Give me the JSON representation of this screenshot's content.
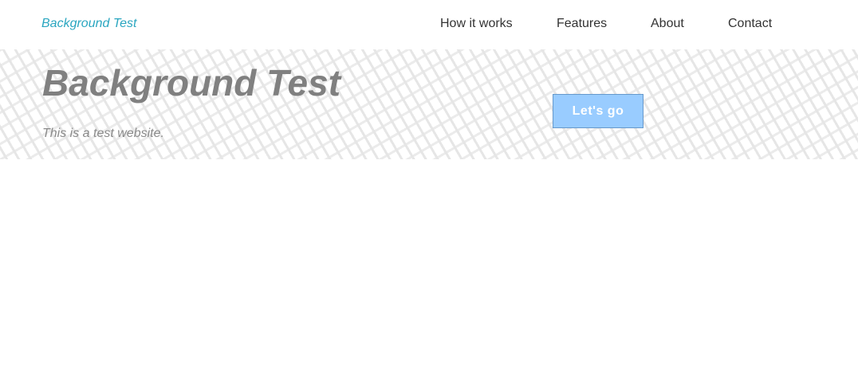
{
  "navbar": {
    "brand": "Background Test",
    "links": [
      "How it works",
      "Features",
      "About",
      "Contact"
    ]
  },
  "hero": {
    "title": "Background Test",
    "subtitle": "This is a test website.",
    "cta_label": "Let's go"
  },
  "colors": {
    "brand": "#2aa6c0",
    "button_bg": "#99ccff",
    "title": "#808080"
  }
}
